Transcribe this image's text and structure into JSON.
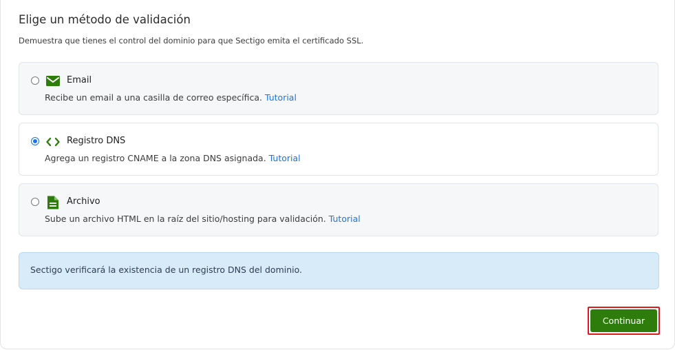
{
  "header": {
    "title": "Elige un método de validación",
    "subtitle": "Demuestra que tienes el control del dominio para que Sectigo emita el certificado SSL."
  },
  "options": [
    {
      "name": "Email",
      "icon": "envelope-icon",
      "description": "Recibe un email a una casilla de correo específica.",
      "link": "Tutorial",
      "selected": false
    },
    {
      "name": "Registro DNS",
      "icon": "code-brackets-icon",
      "description": "Agrega un registro CNAME a la zona DNS asignada.",
      "link": "Tutorial",
      "selected": true
    },
    {
      "name": "Archivo",
      "icon": "document-icon",
      "description": "Sube un archivo HTML en la raíz del sitio/hosting para validación.",
      "link": "Tutorial",
      "selected": false
    }
  ],
  "info": {
    "message": "Sectigo verificará la existencia de un registro DNS del dominio."
  },
  "actions": {
    "continue_label": "Continuar"
  },
  "colors": {
    "accent_green": "#2e7d0c",
    "link_blue": "#1a73e8",
    "info_bg": "#d7ebf8",
    "highlight_red": "#e01818"
  }
}
